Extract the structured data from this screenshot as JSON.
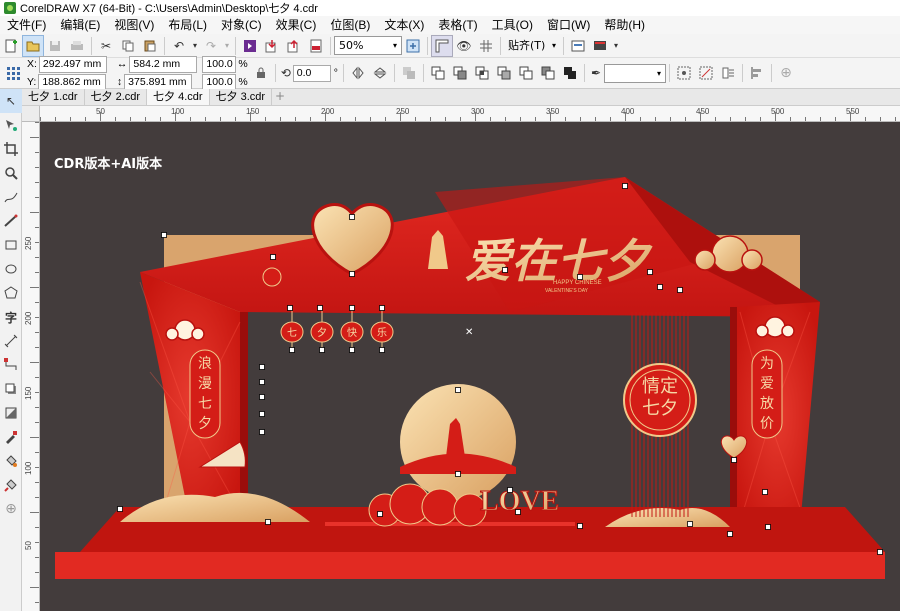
{
  "window": {
    "title": "CorelDRAW X7 (64-Bit) - C:\\Users\\Admin\\Desktop\\七夕 4.cdr"
  },
  "menu": [
    "文件(F)",
    "编辑(E)",
    "视图(V)",
    "布局(L)",
    "对象(C)",
    "效果(C)",
    "位图(B)",
    "文本(X)",
    "表格(T)",
    "工具(O)",
    "窗口(W)",
    "帮助(H)"
  ],
  "toolbar": {
    "zoom": "50%",
    "snap_label": "贴齐(T)"
  },
  "properties": {
    "x_label": "X:",
    "x": "292.497 mm",
    "y_label": "Y:",
    "y": "188.862 mm",
    "width": "584.2 mm",
    "height": "375.891 mm",
    "scale_x": "100.0",
    "scale_y": "100.0",
    "percent": "%",
    "rotation": "0.0",
    "degree": "°"
  },
  "tabs": [
    {
      "label": "七夕 1.cdr"
    },
    {
      "label": "七夕 2.cdr"
    },
    {
      "label": "七夕 4.cdr",
      "active": true
    },
    {
      "label": "七夕 3.cdr"
    }
  ],
  "ruler_h": [
    "50",
    "100",
    "150",
    "200",
    "250",
    "300",
    "350",
    "400",
    "450",
    "500",
    "550"
  ],
  "ruler_v": [
    "250",
    "200",
    "150",
    "100",
    "50"
  ],
  "canvas": {
    "watermark": "CDR版本+AI版本",
    "title_art": "爱在七夕",
    "subtitle_1": "HAPPY CHINESE",
    "subtitle_2": "VALENTINE'S DAY",
    "lanterns": [
      "七",
      "夕",
      "快",
      "乐"
    ],
    "left_banner": [
      "浪",
      "漫",
      "七",
      "夕"
    ],
    "right_banner": [
      "为",
      "爱",
      "放",
      "价"
    ],
    "emblem": [
      "情定",
      "七夕"
    ],
    "love_text": "LOVE",
    "colors": {
      "red": "#d8201e",
      "dark_red": "#b0120f",
      "gold": "#f0c98a",
      "bg": "#433c3c",
      "tan": "#d9a46d"
    }
  }
}
